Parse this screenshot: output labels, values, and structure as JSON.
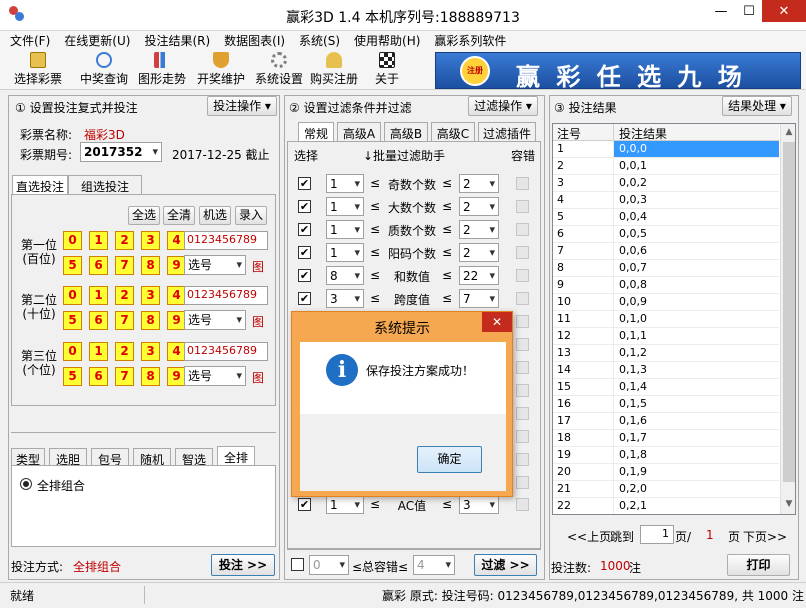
{
  "window": {
    "title": "赢彩3D 1.4 本机序列号:188889713",
    "min": "—",
    "max": "☐",
    "close": "✕"
  },
  "menu": [
    "文件(F)",
    "在线更新(U)",
    "投注结果(R)",
    "数据图表(I)",
    "系统(S)",
    "使用帮助(H)",
    "赢彩系列软件"
  ],
  "toolbar": [
    {
      "label": "选择彩票",
      "icon": "document-icon",
      "color": "#d9a400"
    },
    {
      "label": "中奖查询",
      "icon": "magnifier-icon",
      "color": "#3a7bd5"
    },
    {
      "label": "图形走势",
      "icon": "bar-chart-icon",
      "color": "#d04040"
    },
    {
      "label": "开奖维护",
      "icon": "trophy-icon",
      "color": "#e09020"
    },
    {
      "label": "系统设置",
      "icon": "gear-icon",
      "color": "#808080"
    },
    {
      "label": "购买注册",
      "icon": "key-icon",
      "color": "#d0a000"
    },
    {
      "label": "关于",
      "icon": "flag-icon",
      "color": "#202020"
    }
  ],
  "banner": {
    "logo": "注册",
    "text": "赢 彩 任 选 九 场"
  },
  "p1": {
    "title": "① 设置投注复式并投注",
    "action": "投注操作 ▾",
    "lottery_label": "彩票名称:",
    "lottery_value": "福彩3D",
    "issue_label": "彩票期号:",
    "issue_value": "2017352",
    "issue_date": "2017-12-25 截止",
    "tabs": [
      "直选投注",
      "组选投注"
    ],
    "buttons": [
      "全选",
      "全清",
      "机选",
      "录入"
    ],
    "positions": [
      {
        "name": "第一位\n(百位)",
        "digits": "0123456789"
      },
      {
        "name": "第二位\n(十位)",
        "digits": "0123456789"
      },
      {
        "name": "第三位\n(个位)",
        "digits": "0123456789"
      }
    ],
    "balls": [
      "0",
      "1",
      "2",
      "3",
      "4",
      "5",
      "6",
      "7",
      "8",
      "9"
    ],
    "pick_label": "选号",
    "pick_icon": "图",
    "bottom_tabs": [
      "类型",
      "选胆",
      "包号",
      "随机",
      "智选",
      "全排"
    ],
    "radio_label": "全排组合",
    "mode_label": "投注方式:",
    "mode_value": "全排组合",
    "bet_button": "投注 >>"
  },
  "p2": {
    "title": "② 设置过滤条件并过滤",
    "action": "过滤操作 ▾",
    "tabs": [
      "常规",
      "高级A",
      "高级B",
      "高级C",
      "过滤插件"
    ],
    "col_select": "选择",
    "col_helper": "↓批量过滤助手",
    "col_tol": "容错",
    "rows": [
      {
        "min": "1",
        "label": "奇数个数",
        "max": "2"
      },
      {
        "min": "1",
        "label": "大数个数",
        "max": "2"
      },
      {
        "min": "1",
        "label": "质数个数",
        "max": "2"
      },
      {
        "min": "1",
        "label": "阳码个数",
        "max": "2"
      },
      {
        "min": "8",
        "label": "和数值",
        "max": "22"
      },
      {
        "min": "3",
        "label": "跨度值",
        "max": "7"
      }
    ],
    "last_row": {
      "min": "1",
      "label": "AC值",
      "max": "3"
    },
    "le": "≤",
    "footer_min": "0",
    "footer_label": "≤总容错≤",
    "footer_max": "4",
    "filter_button": "过滤 >>"
  },
  "p3": {
    "title": "③ 投注结果",
    "action": "结果处理 ▾",
    "col_no": "注号",
    "col_result": "投注结果",
    "rows": [
      [
        "1",
        "0,0,0"
      ],
      [
        "2",
        "0,0,1"
      ],
      [
        "3",
        "0,0,2"
      ],
      [
        "4",
        "0,0,3"
      ],
      [
        "5",
        "0,0,4"
      ],
      [
        "6",
        "0,0,5"
      ],
      [
        "7",
        "0,0,6"
      ],
      [
        "8",
        "0,0,7"
      ],
      [
        "9",
        "0,0,8"
      ],
      [
        "10",
        "0,0,9"
      ],
      [
        "11",
        "0,1,0"
      ],
      [
        "12",
        "0,1,1"
      ],
      [
        "13",
        "0,1,2"
      ],
      [
        "14",
        "0,1,3"
      ],
      [
        "15",
        "0,1,4"
      ],
      [
        "16",
        "0,1,5"
      ],
      [
        "17",
        "0,1,6"
      ],
      [
        "18",
        "0,1,7"
      ],
      [
        "19",
        "0,1,8"
      ],
      [
        "20",
        "0,1,9"
      ],
      [
        "21",
        "0,2,0"
      ],
      [
        "22",
        "0,2,1"
      ]
    ],
    "pager": {
      "prev": "<<上页",
      "jump": "跳到",
      "page": "1",
      "page_unit": "页/",
      "total": "1",
      "total_unit": "页",
      "next": "下页>>"
    },
    "count_label": "投注数:",
    "count_value": "1000",
    "count_unit": "注",
    "print": "打印"
  },
  "status": {
    "left": "就绪",
    "right": "赢彩 原式: 投注号码: 0123456789,0123456789,0123456789, 共 1000 注"
  },
  "dialog": {
    "title": "系统提示",
    "message": "保存投注方案成功！",
    "ok": "确定",
    "close": "✕",
    "info": "i"
  }
}
